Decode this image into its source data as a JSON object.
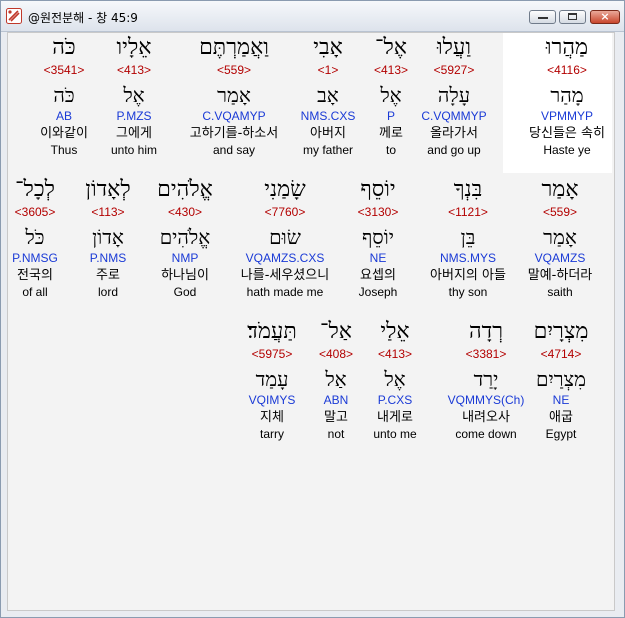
{
  "window": {
    "title": "@원전분해 - 창 45:9",
    "controls": {
      "minimize": "minimize-icon",
      "maximize": "maximize-icon",
      "close": "×"
    }
  },
  "rows": [
    {
      "words": [
        {
          "hebrew": "מַהֲרוּ",
          "strong": "<4116>",
          "lemma": "מָהַר",
          "parse": "VPMMYP",
          "korean": "당신들은 속히",
          "english": "Haste ye",
          "highlighted": true
        },
        {
          "hebrew": "וַעֲלוּ",
          "strong": "<5927>",
          "lemma": "עָלָה",
          "parse": "C.VQMMYP",
          "korean": "올라가서",
          "english": "and go up"
        },
        {
          "hebrew": "אֶל־",
          "strong": "<413>",
          "lemma": "אֶל",
          "parse": "P",
          "korean": "께로",
          "english": "to"
        },
        {
          "hebrew": "אָבִי",
          "strong": "<1>",
          "lemma": "אָב",
          "parse": "NMS.CXS",
          "korean": "아버지",
          "english": "my father"
        },
        {
          "hebrew": "וַאֲמַרְתֶּם",
          "strong": "<559>",
          "lemma": "אָמַר",
          "parse": "C.VQAMYP",
          "korean": "고하기를-하소서",
          "english": "and say"
        },
        {
          "hebrew": "אֵלָיו",
          "strong": "<413>",
          "lemma": "אֶל",
          "parse": "P.MZS",
          "korean": "그에게",
          "english": "unto him"
        },
        {
          "hebrew": "כֹּה",
          "strong": "<3541>",
          "lemma": "כֹּה",
          "parse": "AB",
          "korean": "이와같이",
          "english": "Thus"
        }
      ]
    },
    {
      "words": [
        {
          "hebrew": "אָמַר",
          "strong": "<559>",
          "lemma": "אָמַר",
          "parse": "VQAMZS",
          "korean": "말예-하더라",
          "english": "saith"
        },
        {
          "hebrew": "בִּנְךָ",
          "strong": "<1121>",
          "lemma": "בֵּן",
          "parse": "NMS.MYS",
          "korean": "아버지의 아들",
          "english": "thy son"
        },
        {
          "hebrew": "יוֹסֵף",
          "strong": "<3130>",
          "lemma": "יוֹסֵף",
          "parse": "NE",
          "korean": "요셉의",
          "english": "Joseph"
        },
        {
          "hebrew": "שָׂמַנִי",
          "strong": "<7760>",
          "lemma": "שׂוּם",
          "parse": "VQAMZS.CXS",
          "korean": "나를-세우셨으니",
          "english": "hath made me"
        },
        {
          "hebrew": "אֱלֹהִים",
          "strong": "<430>",
          "lemma": "אֱלֹהִים",
          "parse": "NMP",
          "korean": "하나님이",
          "english": "God"
        },
        {
          "hebrew": "לְאָדוֹן",
          "strong": "<113>",
          "lemma": "אָדוֹן",
          "parse": "P.NMS",
          "korean": "주로",
          "english": "lord"
        },
        {
          "hebrew": "לְכָל־",
          "strong": "<3605>",
          "lemma": "כֹּל",
          "parse": "P.NMSG",
          "korean": "전국의",
          "english": "of all"
        }
      ]
    },
    {
      "words": [
        {
          "hebrew": "מִצְרָיִם",
          "strong": "<4714>",
          "lemma": "מִצְרַיִם",
          "parse": "NE",
          "korean": "애굽",
          "english": "Egypt"
        },
        {
          "hebrew": "רְדָה",
          "strong": "<3381>",
          "lemma": "יָרַד",
          "parse": "VQMMYS(Ch)",
          "korean": "내려오사",
          "english": "come down"
        },
        {
          "hebrew": "אֵלַי",
          "strong": "<413>",
          "lemma": "אֶל",
          "parse": "P.CXS",
          "korean": "내게로",
          "english": "unto me"
        },
        {
          "hebrew": "אַל־",
          "strong": "<408>",
          "lemma": "אַל",
          "parse": "ABN",
          "korean": "말고",
          "english": "not"
        },
        {
          "hebrew": "תַּעֲמֹד׃",
          "strong": "<5975>",
          "lemma": "עָמַד",
          "parse": "VQIMYS",
          "korean": "지체",
          "english": "tarry"
        }
      ]
    }
  ]
}
